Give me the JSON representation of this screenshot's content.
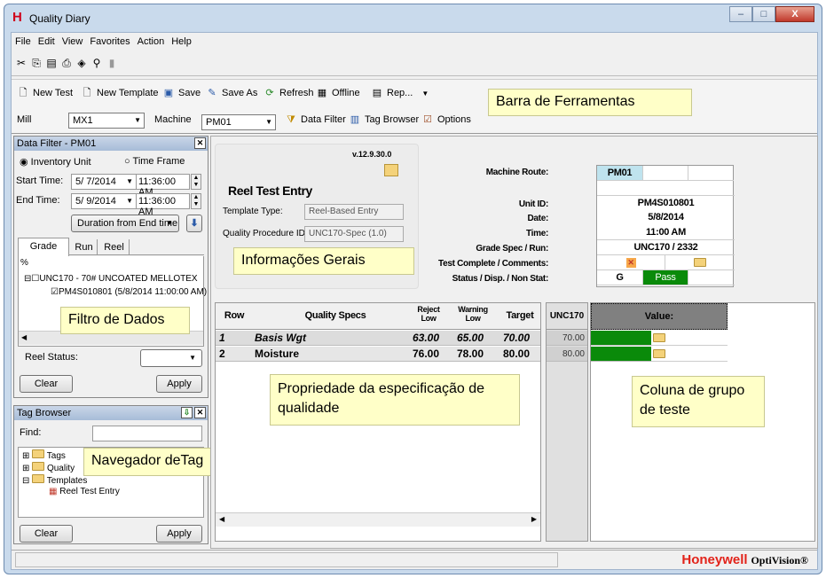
{
  "window": {
    "title": "Quality Diary",
    "controls": {
      "minimize": "–",
      "maximize": "□",
      "close": "X"
    }
  },
  "menu": [
    "File",
    "Edit",
    "View",
    "Favorites",
    "Action",
    "Help"
  ],
  "toolbar": {
    "new_test": "New Test",
    "new_template": "New Template",
    "save": "Save",
    "save_as": "Save As",
    "refresh": "Refresh",
    "offline": "Offline",
    "rep": "Rep...",
    "mill_label": "Mill",
    "mill_value": "MX1",
    "machine_label": "Machine",
    "machine_value": "PM01",
    "data_filter": "Data Filter",
    "tag_browser": "Tag Browser",
    "options": "Options"
  },
  "callouts": {
    "toolbar": "Barra de Ferramentas",
    "general": "Informações Gerais",
    "filter": "Filtro de Dados",
    "spec": "Propriedade da especificação de qualidade",
    "group": "Coluna de grupo de teste",
    "tag": "Navegador deTag"
  },
  "data_filter": {
    "title": "Data Filter - PM01",
    "radio_inventory": "Inventory Unit",
    "radio_time": "Time Frame",
    "start_label": "Start Time:",
    "start_date": "5/ 7/2014",
    "start_time": "11:36:00 AM",
    "end_label": "End Time:",
    "end_date": "5/ 9/2014",
    "end_time": "11:36:00 AM",
    "duration": "Duration from End time",
    "tabs": [
      "Grade Spec",
      "Run",
      "Reel"
    ],
    "percent": "%",
    "tree_parent": "UNC170 - 70# UNCOATED MELLOTEX",
    "tree_child": "PM4S010801 (5/8/2014 11:00:00 AM)",
    "reel_status_label": "Reel Status:",
    "clear": "Clear",
    "apply": "Apply"
  },
  "tag_browser": {
    "title": "Tag Browser",
    "find_label": "Find:",
    "tree": [
      "Tags",
      "Quality",
      "Templates",
      "Reel Test Entry"
    ],
    "clear": "Clear",
    "apply": "Apply"
  },
  "entry": {
    "version": "v.12.9.30.0",
    "heading": "Reel Test Entry",
    "template_type_label": "Template Type:",
    "template_type_value": "Reel-Based Entry",
    "qp_label": "Quality Procedure ID:",
    "qp_value": "UNC170-Spec (1.0)"
  },
  "header_info": {
    "labels": [
      "Machine Route:",
      "Unit ID:",
      "Date:",
      "Time:",
      "Grade Spec / Run:",
      "Test Complete / Comments:",
      "Status / Disp. / Non Stat:"
    ],
    "machine": "PM01",
    "unit_id": "PM4S010801",
    "date": "5/8/2014",
    "time": "11:00 AM",
    "grade_run": "UNC170 / 2332",
    "status_g": "G",
    "status_pass": "Pass"
  },
  "spec_table": {
    "headers": [
      "Row",
      "Quality Specs",
      "Reject Low",
      "Warning Low",
      "Target"
    ],
    "rows": [
      {
        "row": "1",
        "spec": "Basis Wgt",
        "reject": "63.00",
        "warning": "65.00",
        "target": "70.00"
      },
      {
        "row": "2",
        "spec": "Moisture",
        "reject": "76.00",
        "warning": "78.00",
        "target": "80.00"
      }
    ]
  },
  "group_col": {
    "header": "UNC170",
    "values": [
      "70.00",
      "80.00"
    ]
  },
  "value_col": {
    "header": "Value:"
  },
  "brand": {
    "name": "Honeywell",
    "product": "OptiVision®"
  }
}
